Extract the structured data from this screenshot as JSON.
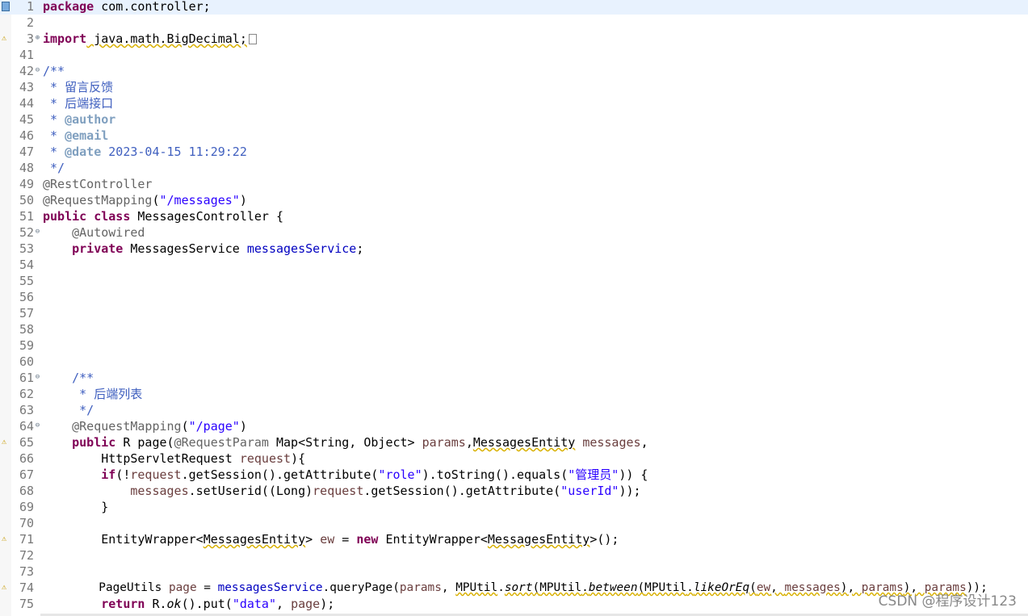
{
  "watermark": "CSDN @程序设计123",
  "code": {
    "l1": {
      "n": "1",
      "p1": "package",
      "p2": " com.controller;"
    },
    "l2": {
      "n": "2"
    },
    "l3": {
      "n": "3",
      "p1": "import",
      "p2": " java.math.BigDecimal;"
    },
    "l41": {
      "n": "41"
    },
    "l42": {
      "n": "42",
      "p1": "/**"
    },
    "l43": {
      "n": "43",
      "p1": " * 留言反馈"
    },
    "l44": {
      "n": "44",
      "p1": " * 后端接口"
    },
    "l45": {
      "n": "45",
      "p1": " * ",
      "p2": "@author"
    },
    "l46": {
      "n": "46",
      "p1": " * ",
      "p2": "@email"
    },
    "l47": {
      "n": "47",
      "p1": " * ",
      "p2": "@date",
      "p3": " 2023-04-15 11:29:22"
    },
    "l48": {
      "n": "48",
      "p1": " */"
    },
    "l49": {
      "n": "49",
      "p1": "@RestController"
    },
    "l50": {
      "n": "50",
      "p1": "@RequestMapping",
      "p2": "(",
      "p3": "\"/messages\"",
      "p4": ")"
    },
    "l51": {
      "n": "51",
      "p1": "public",
      "p2": " ",
      "p3": "class",
      "p4": " MessagesController {"
    },
    "l52": {
      "n": "52",
      "p1": "    ",
      "p2": "@Autowired"
    },
    "l53": {
      "n": "53",
      "p1": "    ",
      "p2": "private",
      "p3": " MessagesService ",
      "p4": "messagesService",
      "p5": ";"
    },
    "l54": {
      "n": "54"
    },
    "l55": {
      "n": "55"
    },
    "l56": {
      "n": "56"
    },
    "l57": {
      "n": "57"
    },
    "l58": {
      "n": "58"
    },
    "l59": {
      "n": "59"
    },
    "l60": {
      "n": "60"
    },
    "l61": {
      "n": "61",
      "p1": "    /**"
    },
    "l62": {
      "n": "62",
      "p1": "     * 后端列表"
    },
    "l63": {
      "n": "63",
      "p1": "     */"
    },
    "l64": {
      "n": "64",
      "p1": "    ",
      "p2": "@RequestMapping",
      "p3": "(",
      "p4": "\"/page\"",
      "p5": ")"
    },
    "l65": {
      "n": "65",
      "p1": "    ",
      "p2": "public",
      "p3": " R page(",
      "p4": "@RequestParam",
      "p5": " Map<String, Object> ",
      "p6": "params",
      "p7": ",",
      "p8": "MessagesEntity",
      "p9": " ",
      "p10": "messages",
      "p11": ","
    },
    "l66": {
      "n": "66",
      "p1": "        HttpServletRequest ",
      "p2": "request",
      "p3": "){"
    },
    "l67": {
      "n": "67",
      "p1": "        ",
      "p2": "if",
      "p3": "(!",
      "p4": "request",
      "p5": ".getSession().getAttribute(",
      "p6": "\"role\"",
      "p7": ").toString().equals(",
      "p8": "\"管理员\"",
      "p9": ")) {"
    },
    "l68": {
      "n": "68",
      "p1": "            ",
      "p2": "messages",
      "p3": ".setUserid((Long)",
      "p4": "request",
      "p5": ".getSession().getAttribute(",
      "p6": "\"userId\"",
      "p7": "));"
    },
    "l69": {
      "n": "69",
      "p1": "        }"
    },
    "l70": {
      "n": "70"
    },
    "l71": {
      "n": "71",
      "p1": "        EntityWrapper<",
      "p2": "MessagesEntity",
      "p3": "> ",
      "p4": "ew",
      "p5": " = ",
      "p6": "new",
      "p7": " EntityWrapper<",
      "p8": "MessagesEntity",
      "p9": ">();"
    },
    "l72": {
      "n": "72"
    },
    "l73": {
      "n": "73"
    },
    "l74": {
      "n": "74",
      "p1": "        PageUtils ",
      "p2": "page",
      "p3": " = ",
      "p4": "messagesService",
      "p5": ".queryPage(",
      "p6": "params",
      "p7": ", ",
      "p8": "MPUtil",
      "p9": ".",
      "p10": "sort",
      "p11": "(",
      "p12": "MPUtil",
      "p13": ".",
      "p14": "between",
      "p15": "(",
      "p16": "MPUtil",
      "p17": ".",
      "p18": "likeOrEq",
      "p19": "(",
      "p20": "ew",
      "p21": ", ",
      "p22": "messages",
      "p23": "), ",
      "p24": "params",
      "p25": "), ",
      "p26": "params",
      "p27": "));"
    },
    "l75": {
      "n": "75",
      "p1": "        ",
      "p2": "return",
      "p3": " R.",
      "p4": "ok",
      "p5": "().put(",
      "p6": "\"data\"",
      "p7": ", ",
      "p8": "page",
      "p9": ");"
    }
  }
}
